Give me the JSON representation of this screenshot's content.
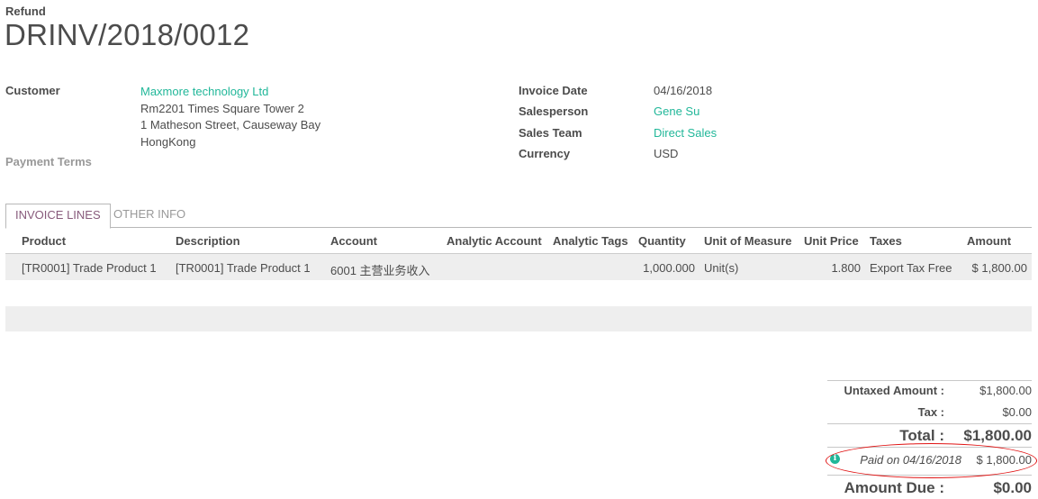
{
  "header": {
    "doc_type": "Refund",
    "doc_number": "DRINV/2018/0012"
  },
  "customer": {
    "label": "Customer",
    "name": "Maxmore technology Ltd",
    "address": [
      "Rm2201 Times Square Tower 2",
      "1 Matheson Street, Causeway Bay",
      "HongKong"
    ]
  },
  "payment_terms": {
    "label": "Payment Terms",
    "value": ""
  },
  "invoice_info": {
    "invoice_date_label": "Invoice Date",
    "invoice_date": "04/16/2018",
    "salesperson_label": "Salesperson",
    "salesperson": "Gene Su",
    "sales_team_label": "Sales Team",
    "sales_team": "Direct Sales",
    "currency_label": "Currency",
    "currency": "USD"
  },
  "tabs": [
    {
      "label": "INVOICE LINES",
      "active": true
    },
    {
      "label": "OTHER INFO",
      "active": false
    }
  ],
  "table": {
    "columns": [
      "Product",
      "Description",
      "Account",
      "Analytic Account",
      "Analytic Tags",
      "Quantity",
      "Unit of Measure",
      "Unit Price",
      "Taxes",
      "Amount"
    ],
    "rows": [
      {
        "product": "[TR0001] Trade Product 1",
        "description": "[TR0001] Trade Product 1",
        "account": "6001 主营业务收入",
        "analytic_account": "",
        "analytic_tags": "",
        "quantity": "1,000.000",
        "uom": "Unit(s)",
        "unit_price": "1.800",
        "taxes": "Export Tax Free",
        "amount": "$ 1,800.00"
      }
    ]
  },
  "totals": {
    "untaxed_label": "Untaxed Amount :",
    "untaxed_value": "$1,800.00",
    "tax_label": "Tax :",
    "tax_value": "$0.00",
    "total_label": "Total :",
    "total_value": "$1,800.00",
    "paid_label": "Paid on 04/16/2018",
    "paid_value": "$ 1,800.00",
    "amount_due_label": "Amount Due :",
    "amount_due_value": "$0.00"
  },
  "colors": {
    "link": "#21b799",
    "text": "#4c4c4c",
    "active_tab": "#875a7b",
    "annotation": "#e01414"
  },
  "icons": {
    "paid_info": "info-icon"
  }
}
